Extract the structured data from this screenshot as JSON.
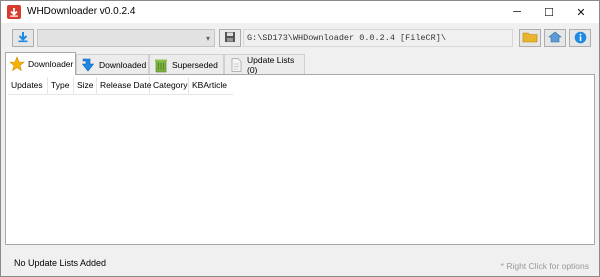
{
  "window": {
    "title": "WHDownloader v0.0.2.4",
    "controls": {
      "minimize": "─",
      "maximize": "☐",
      "close": "✕"
    }
  },
  "toolbar": {
    "download_icon": "download-arrow-icon",
    "update_selector_value": "",
    "save_icon": "floppy-disk-icon",
    "path": "G:\\SD173\\WHDownloader 0.0.2.4 [FileCR]\\",
    "folder_icon": "folder-icon",
    "home_icon": "home-icon",
    "info_icon": "info-icon"
  },
  "tabs": [
    {
      "label": "Downloader",
      "icon": "star-icon",
      "active": true
    },
    {
      "label": "Downloaded",
      "icon": "blue-arrow-icon",
      "active": false
    },
    {
      "label": "Superseded",
      "icon": "bin-icon",
      "active": false
    },
    {
      "label": "Update Lists (0)",
      "icon": "document-icon",
      "active": false
    }
  ],
  "table": {
    "columns": [
      "Updates",
      "Type",
      "Size",
      "Release Date",
      "Category",
      "KBArticle"
    ],
    "rows": []
  },
  "status": {
    "left": "No Update Lists Added",
    "right": "* Right Click for options"
  },
  "colors": {
    "title_bg": "#ffffff",
    "chrome": "#f0f0f0",
    "accent_blue": "#1e88e5",
    "folder_yellow": "#e8b42c",
    "star_yellow": "#f5b301"
  }
}
